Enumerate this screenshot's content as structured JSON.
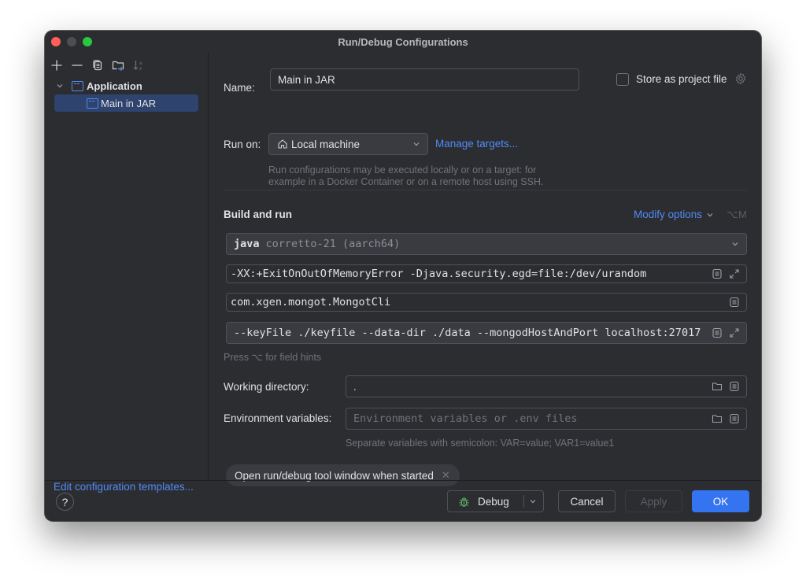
{
  "window": {
    "title": "Run/Debug Configurations"
  },
  "sidebar": {
    "toolbar": [
      {
        "name": "add",
        "icon": "plus-icon",
        "enabled": true
      },
      {
        "name": "remove",
        "icon": "minus-icon",
        "enabled": true
      },
      {
        "name": "copy",
        "icon": "copy-icon",
        "enabled": true
      },
      {
        "name": "new-folder",
        "icon": "folder-add-icon",
        "enabled": true
      },
      {
        "name": "sort",
        "icon": "sort-alpha-icon",
        "enabled": false
      }
    ],
    "tree": {
      "group_label": "Application",
      "items": [
        {
          "label": "Main in JAR",
          "selected": true
        }
      ]
    },
    "edit_templates_link": "Edit configuration templates..."
  },
  "form": {
    "name_label": "Name:",
    "name_value": "Main in JAR",
    "store_as_project_file_label": "Store as project file",
    "store_as_project_file_checked": false,
    "run_on_label": "Run on:",
    "run_on_value": "Local machine",
    "manage_targets_link": "Manage targets...",
    "run_on_hint_line1": "Run configurations may be executed locally or on a target: for",
    "run_on_hint_line2": "example in a Docker Container or on a remote host using SSH.",
    "build_and_run_title": "Build and run",
    "modify_options_label": "Modify options",
    "modify_options_shortcut": "⌥M",
    "jdk_keyword": "java",
    "jdk_value": "corretto-21 (aarch64)",
    "vm_options": "-XX:+ExitOnOutOfMemoryError -Djava.security.egd=file:/dev/urandom",
    "main_class": "com.xgen.mongot.MongotCli",
    "program_arguments": "--keyFile ./keyfile --data-dir ./data --mongodHostAndPort localhost:27017",
    "field_hints": "Press ⌥ for field hints",
    "working_directory_label": "Working directory:",
    "working_directory_value": ".",
    "env_vars_label": "Environment variables:",
    "env_vars_placeholder": "Environment variables or .env files",
    "env_vars_hint": "Separate variables with semicolon: VAR=value; VAR1=value1",
    "chip_label": "Open run/debug tool window when started"
  },
  "footer": {
    "help_label": "?",
    "debug_label": "Debug",
    "cancel_label": "Cancel",
    "apply_label": "Apply",
    "ok_label": "OK"
  },
  "colors": {
    "accent": "#3574f0",
    "link": "#548af7",
    "background": "#2b2d30",
    "selection": "#2e436e",
    "debug_icon": "#5fb865"
  }
}
